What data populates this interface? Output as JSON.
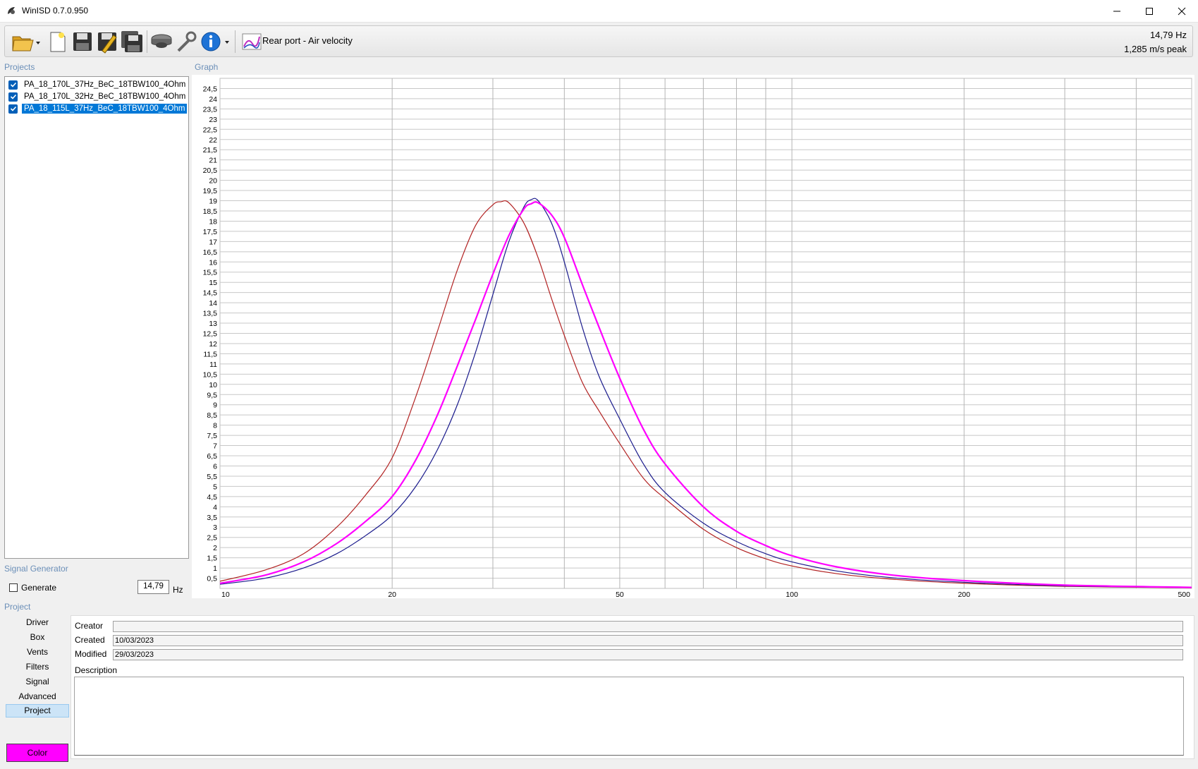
{
  "window": {
    "title": "WinISD 0.7.0.950"
  },
  "toolbar": {
    "graph_selector_label": "Rear port - Air velocity",
    "readout_freq": "14,79 Hz",
    "readout_value": "1,285 m/s peak"
  },
  "projects": {
    "label": "Projects",
    "items": [
      {
        "name": "PA_18_170L_37Hz_BeC_18TBW100_4Ohm",
        "checked": true,
        "selected": false
      },
      {
        "name": "PA_18_170L_32Hz_BeC_18TBW100_4Ohm",
        "checked": true,
        "selected": false
      },
      {
        "name": "PA_18_115L_37Hz_BeC_18TBW100_4Ohm",
        "checked": true,
        "selected": true
      }
    ]
  },
  "graph": {
    "label": "Graph"
  },
  "signal_generator": {
    "label": "Signal Generator",
    "generate_label": "Generate",
    "frequency_value": "14,79",
    "unit": "Hz"
  },
  "project": {
    "label": "Project",
    "nav": [
      "Driver",
      "Box",
      "Vents",
      "Filters",
      "Signal",
      "Advanced",
      "Project"
    ],
    "active": "Project",
    "color_button": "Color",
    "color_value": "#ff00ff",
    "fields": {
      "creator_label": "Creator",
      "creator_value": "",
      "created_label": "Created",
      "created_value": "10/03/2023",
      "modified_label": "Modified",
      "modified_value": "29/03/2023",
      "description_label": "Description"
    }
  },
  "chart_data": {
    "type": "line",
    "xscale": "log",
    "xlim": [
      10,
      500
    ],
    "ylim": [
      0,
      25
    ],
    "x_ticks": [
      "10",
      "20",
      "50",
      "100",
      "200",
      "500"
    ],
    "y_ticks": [
      "0,5",
      "1",
      "1,5",
      "2",
      "2,5",
      "3",
      "3,5",
      "4",
      "4,5",
      "5",
      "5,5",
      "6",
      "6,5",
      "7",
      "7,5",
      "8",
      "8,5",
      "9",
      "9,5",
      "10",
      "10,5",
      "11",
      "11,5",
      "12",
      "12,5",
      "13",
      "13,5",
      "14",
      "14,5",
      "15",
      "15,5",
      "16",
      "16,5",
      "17",
      "17,5",
      "18",
      "18,5",
      "19",
      "19,5",
      "20",
      "20,5",
      "21",
      "21,5",
      "22",
      "22,5",
      "23",
      "23,5",
      "24",
      "24,5"
    ],
    "grid": true,
    "series": [
      {
        "color": "#b22222",
        "x": [
          10,
          12,
          14,
          16,
          18,
          20,
          22,
          24,
          26,
          28,
          30,
          31,
          32,
          34,
          36,
          38,
          40,
          43,
          46,
          50,
          55,
          60,
          70,
          80,
          90,
          100,
          120,
          150,
          200,
          300,
          500
        ],
        "y": [
          0.35,
          0.9,
          1.7,
          3.0,
          4.6,
          6.4,
          9.4,
          12.6,
          15.6,
          17.8,
          18.8,
          18.95,
          18.9,
          17.9,
          16.2,
          14.2,
          12.4,
          10.1,
          8.7,
          7.1,
          5.4,
          4.4,
          2.9,
          2.0,
          1.45,
          1.1,
          0.72,
          0.45,
          0.25,
          0.1,
          0.03
        ]
      },
      {
        "color": "#1a1a8c",
        "x": [
          10,
          12,
          14,
          16,
          18,
          20,
          22,
          24,
          26,
          28,
          30,
          32,
          34,
          35,
          36,
          38,
          40,
          43,
          46,
          50,
          55,
          60,
          70,
          80,
          90,
          100,
          120,
          150,
          200,
          300,
          500
        ],
        "y": [
          0.2,
          0.5,
          1.0,
          1.7,
          2.6,
          3.6,
          5.0,
          6.8,
          9.0,
          11.6,
          14.4,
          17.0,
          18.7,
          19.05,
          19.0,
          17.9,
          16.0,
          12.8,
          10.4,
          8.3,
          6.1,
          4.7,
          3.2,
          2.3,
          1.7,
          1.3,
          0.85,
          0.52,
          0.3,
          0.12,
          0.04
        ]
      },
      {
        "color": "#ff00ff",
        "x": [
          10,
          12,
          14,
          16,
          18,
          20,
          22,
          24,
          26,
          28,
          30,
          32,
          34,
          35,
          36,
          38,
          40,
          43,
          46,
          50,
          55,
          60,
          70,
          80,
          90,
          100,
          120,
          150,
          200,
          300,
          500
        ],
        "y": [
          0.25,
          0.65,
          1.3,
          2.2,
          3.3,
          4.5,
          6.3,
          8.5,
          10.9,
          13.2,
          15.4,
          17.3,
          18.6,
          18.85,
          18.9,
          18.3,
          17.2,
          14.9,
          12.8,
          10.3,
          7.8,
          6.1,
          4.0,
          2.8,
          2.1,
          1.6,
          1.05,
          0.65,
          0.38,
          0.16,
          0.05
        ]
      }
    ]
  }
}
